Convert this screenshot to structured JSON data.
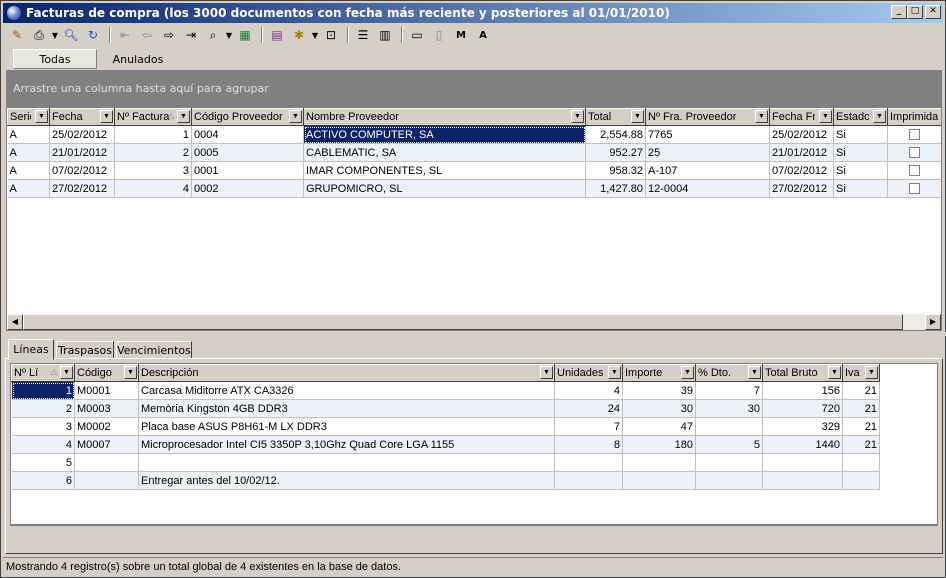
{
  "window": {
    "title": "Facturas de compra (los 3000 documentos con fecha más reciente y posteriores al 01/01/2010)"
  },
  "toolbar": {
    "icons": [
      "edit-icon",
      "print-icon",
      "dropdown-icon",
      "search-icon",
      "refresh-icon",
      "first-record-icon",
      "previous-record-icon",
      "next-record-icon",
      "last-record-icon",
      "preview-icon",
      "excel-export-icon",
      "form-icon",
      "filter-icon",
      "dropdown-icon",
      "select-icon",
      "columns-icon",
      "grid-layout-icon",
      "window-icon",
      "blank-doc-icon",
      "m-doc-icon",
      "a-doc-icon"
    ]
  },
  "top_tabs": {
    "all": "Todas",
    "cancelled": "Anulados"
  },
  "group_area": {
    "hint": "Arrastre una columna hasta aquí para agrupar"
  },
  "invoices": {
    "columns": [
      "Serie",
      "Fecha",
      "Nº Factura",
      "Código Proveedor",
      "Nombre Proveedor",
      "Total",
      "Nº Fra. Proveedor",
      "Fecha Fra. Proveedor",
      "Estado",
      "Imprimida"
    ],
    "rows": [
      {
        "serie": "A",
        "fecha": "25/02/2012",
        "num": "1",
        "codigo": "0004",
        "nombre": "ACTIVO COMPUTER, SA",
        "total": "2,554.88",
        "fra": "7765",
        "fechafra": "25/02/2012",
        "estado": "Si"
      },
      {
        "serie": "A",
        "fecha": "21/01/2012",
        "num": "2",
        "codigo": "0005",
        "nombre": "CABLEMATIC, SA",
        "total": "952.27",
        "fra": "25",
        "fechafra": "21/01/2012",
        "estado": "Si"
      },
      {
        "serie": "A",
        "fecha": "07/02/2012",
        "num": "3",
        "codigo": "0001",
        "nombre": "IMAR COMPONENTES, SL",
        "total": "958.32",
        "fra": "A-107",
        "fechafra": "07/02/2012",
        "estado": "Si"
      },
      {
        "serie": "A",
        "fecha": "27/02/2012",
        "num": "4",
        "codigo": "0002",
        "nombre": "GRUPOMICRO, SL",
        "total": "1,427.80",
        "fra": "12-0004",
        "fechafra": "27/02/2012",
        "estado": "Si"
      }
    ]
  },
  "bottom_tabs": {
    "lines": "Líneas",
    "transfers": "Traspasos",
    "due": "Vencimientos"
  },
  "lines": {
    "columns": [
      "Nº Línea",
      "Código",
      "Descripción",
      "Unidades",
      "Importe",
      "% Dto.",
      "Total Bruto",
      "Iva"
    ],
    "rows": [
      {
        "n": "1",
        "codigo": "M0001",
        "desc": "Carcasa Miditorre ATX CA3326",
        "uds": "4",
        "imp": "39",
        "dto": "7",
        "bruto": "156",
        "iva": "21"
      },
      {
        "n": "2",
        "codigo": "M0003",
        "desc": "Memòria Kingston 4GB DDR3",
        "uds": "24",
        "imp": "30",
        "dto": "30",
        "bruto": "720",
        "iva": "21"
      },
      {
        "n": "3",
        "codigo": "M0002",
        "desc": "Placa base ASUS P8H61-M LX DDR3",
        "uds": "7",
        "imp": "47",
        "dto": "",
        "bruto": "329",
        "iva": "21"
      },
      {
        "n": "4",
        "codigo": "M0007",
        "desc": "Microprocesador Intel CI5 3350P 3,10Ghz Quad Core LGA 1155",
        "uds": "8",
        "imp": "180",
        "dto": "5",
        "bruto": "1440",
        "iva": "21"
      },
      {
        "n": "5",
        "codigo": "",
        "desc": "",
        "uds": "",
        "imp": "",
        "dto": "",
        "bruto": "",
        "iva": ""
      },
      {
        "n": "6",
        "codigo": "",
        "desc": "Entregar antes del 10/02/12.",
        "uds": "",
        "imp": "",
        "dto": "",
        "bruto": "",
        "iva": ""
      }
    ]
  },
  "status": {
    "text": "Mostrando 4 registro(s) sobre un total global de 4 existentes en la base de datos."
  }
}
